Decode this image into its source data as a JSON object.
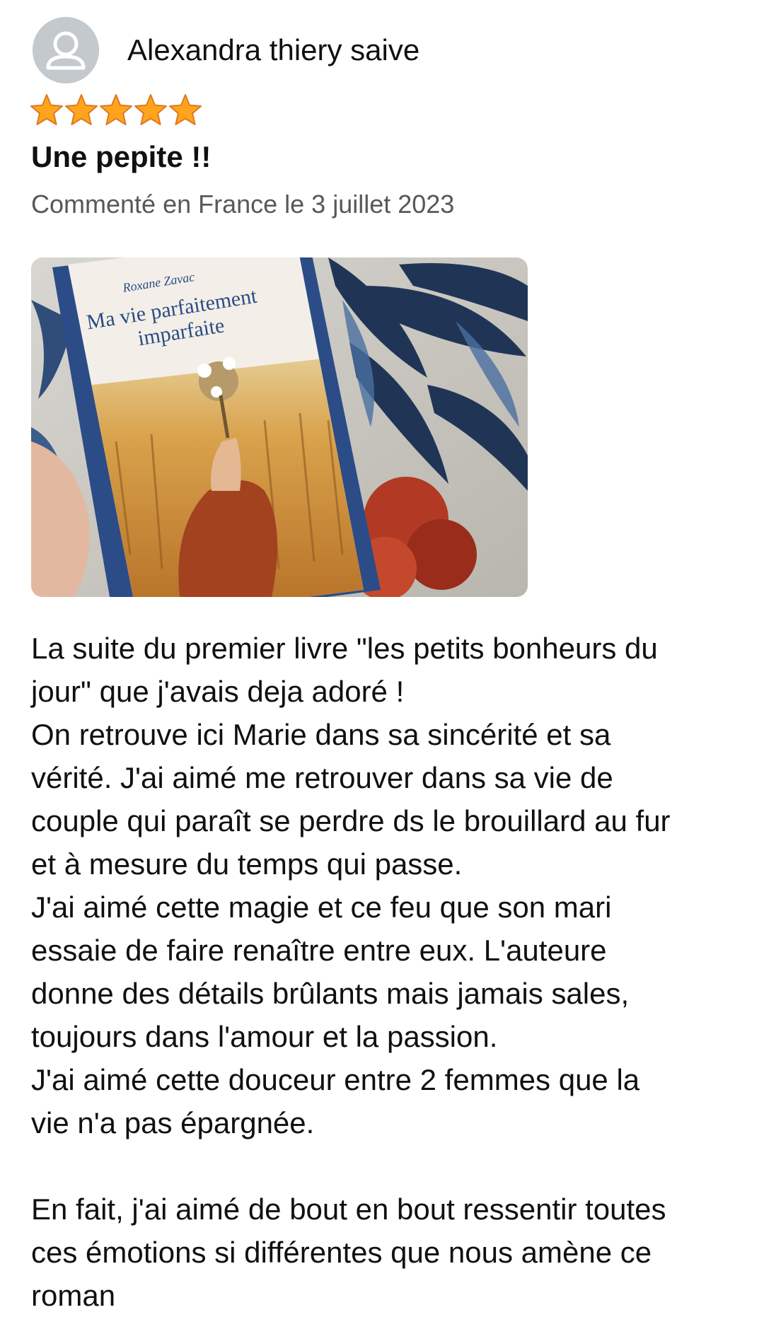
{
  "reviewer": {
    "name": "Alexandra thiery saive",
    "avatar_icon": "default-user-avatar-icon"
  },
  "rating": {
    "stars": 5,
    "max": 5,
    "color": "#ffa41c"
  },
  "review": {
    "title": "Une pepite !!",
    "meta": "Commenté en France le 3 juillet 2023",
    "image": {
      "book_author": "Roxane Zavac",
      "book_title_line1": "Ma vie parfaitement",
      "book_title_line2": "imparfaite"
    },
    "body_lines": [
      "La suite du premier livre \"les petits bonheurs du",
      "jour\" que j'avais deja adoré !",
      "On retrouve ici Marie dans sa sincérité et sa",
      "vérité. J'ai aimé me retrouver dans sa vie de",
      "couple qui paraît se perdre ds le brouillard au fur",
      "et à mesure du temps qui passe.",
      "J'ai aimé cette magie et ce feu que son mari",
      "essaie de faire renaître entre eux. L'auteure",
      "donne des détails brûlants mais jamais sales,",
      "toujours dans l'amour et la passion.",
      "J'ai aimé cette douceur entre 2 femmes que la",
      "vie n'a pas épargnée.",
      "",
      "En fait, j'ai aimé de bout en bout ressentir toutes",
      "ces émotions si différentes que nous amène ce",
      "roman"
    ]
  }
}
